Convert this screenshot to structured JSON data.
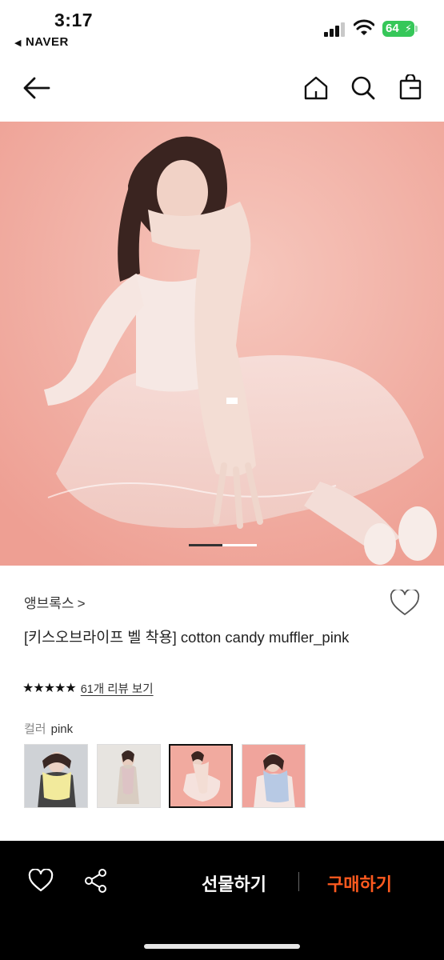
{
  "status_bar": {
    "time": "3:17",
    "back_app": "NAVER",
    "battery": "64"
  },
  "product": {
    "brand": "앵브록스",
    "brand_chevron": ">",
    "title": "[키스오브라이프 벨 착용] cotton candy muffler_pink",
    "rating_stars": "★★★★★",
    "rating_value": 4.5,
    "review_link": "61개 리뷰 보기",
    "color_label": "컬러",
    "color_value": "pink",
    "color_options": [
      "yellow",
      "beige",
      "pink",
      "blue"
    ],
    "selected_color_index": 2,
    "image_page": {
      "current": 1,
      "total": 2
    }
  },
  "bottom_bar": {
    "gift_label": "선물하기",
    "buy_label": "구매하기"
  },
  "colors": {
    "accent_buy": "#ff5a1f",
    "hero_bg": "#f2b3a8",
    "battery": "#36c759"
  },
  "icons": [
    "back-arrow-icon",
    "home-icon",
    "search-icon",
    "shopping-bag-icon",
    "heart-icon",
    "share-icon"
  ]
}
